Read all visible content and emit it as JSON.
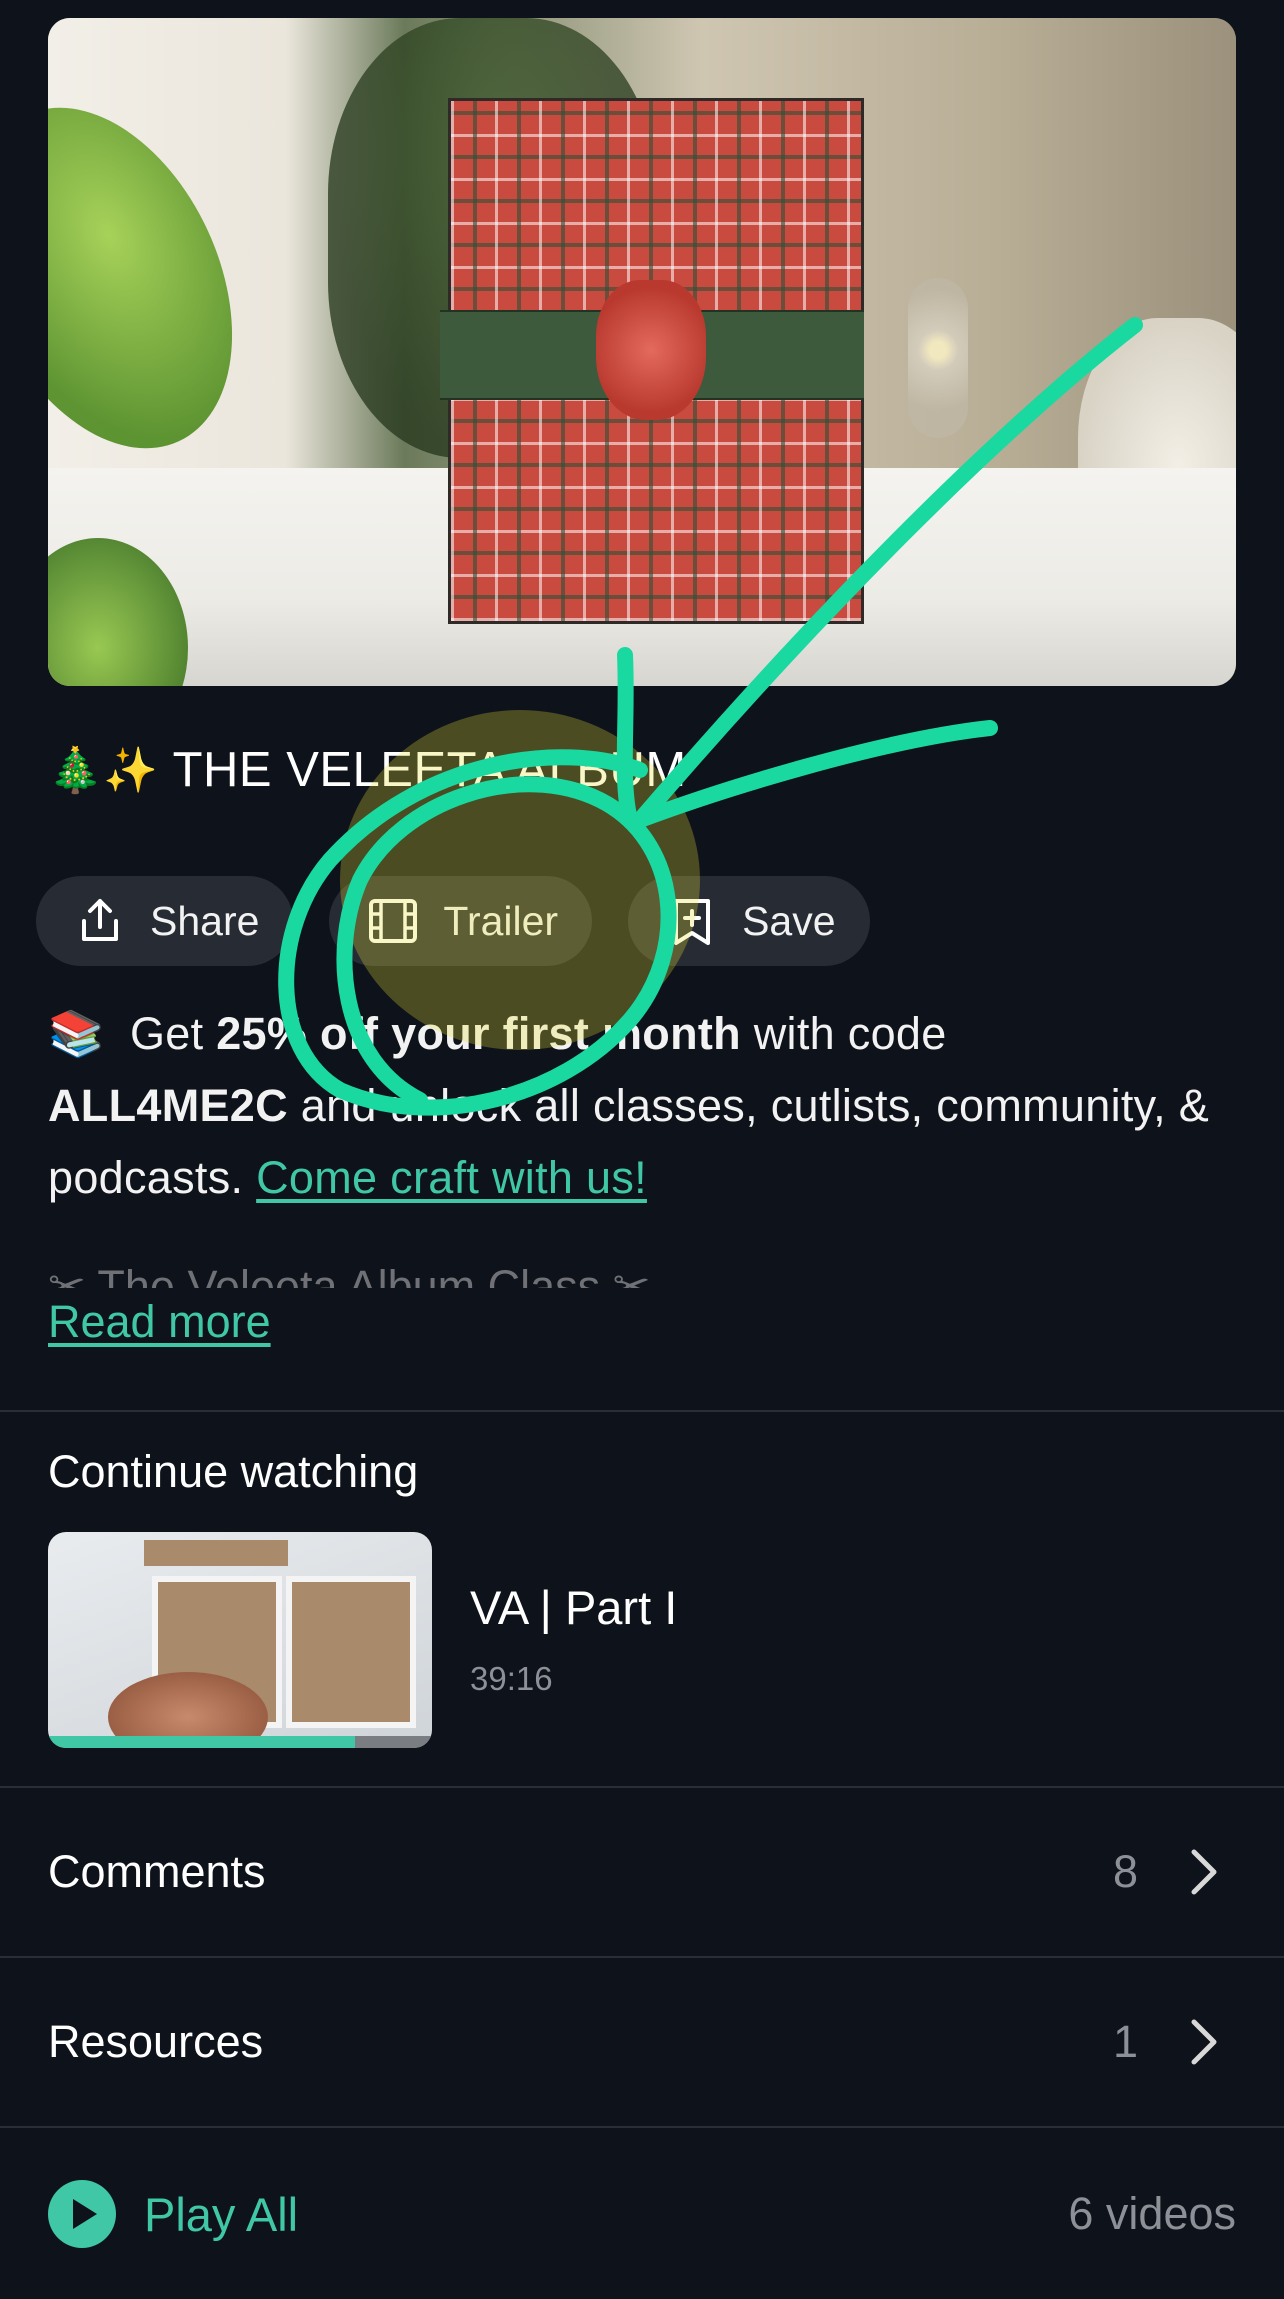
{
  "hero": {
    "image_description_icon": "gift-box-photo"
  },
  "title": {
    "emoji": "🎄✨",
    "text": "THE VELEETA ALBUM"
  },
  "actions": {
    "share_label": "Share",
    "trailer_label": "Trailer",
    "save_label": "Save"
  },
  "promo": {
    "emoji": "📚",
    "text_1": "Get",
    "bold_1": "25% off your first month",
    "text_2": "with code",
    "code": "ALL4ME2C",
    "text_3": "and unlock all classes, cutlists, community, & podcasts.",
    "link": "Come craft with us!"
  },
  "description_preview": "✂ The Veleeta Album Class ✂",
  "read_more": "Read more",
  "continue_watching": {
    "heading": "Continue watching",
    "episode_title": "VA | Part I",
    "duration": "39:16",
    "progress": 0.8
  },
  "comments": {
    "label": "Comments",
    "count": "8"
  },
  "resources": {
    "label": "Resources",
    "count": "1"
  },
  "play_all": {
    "label": "Play All",
    "videos": "6 videos"
  },
  "colors": {
    "accent": "#3fc7a6",
    "background": "#0e121a",
    "pill": "#272b33",
    "scribble": "#19d9a0",
    "highlight": "#e8e43a"
  }
}
